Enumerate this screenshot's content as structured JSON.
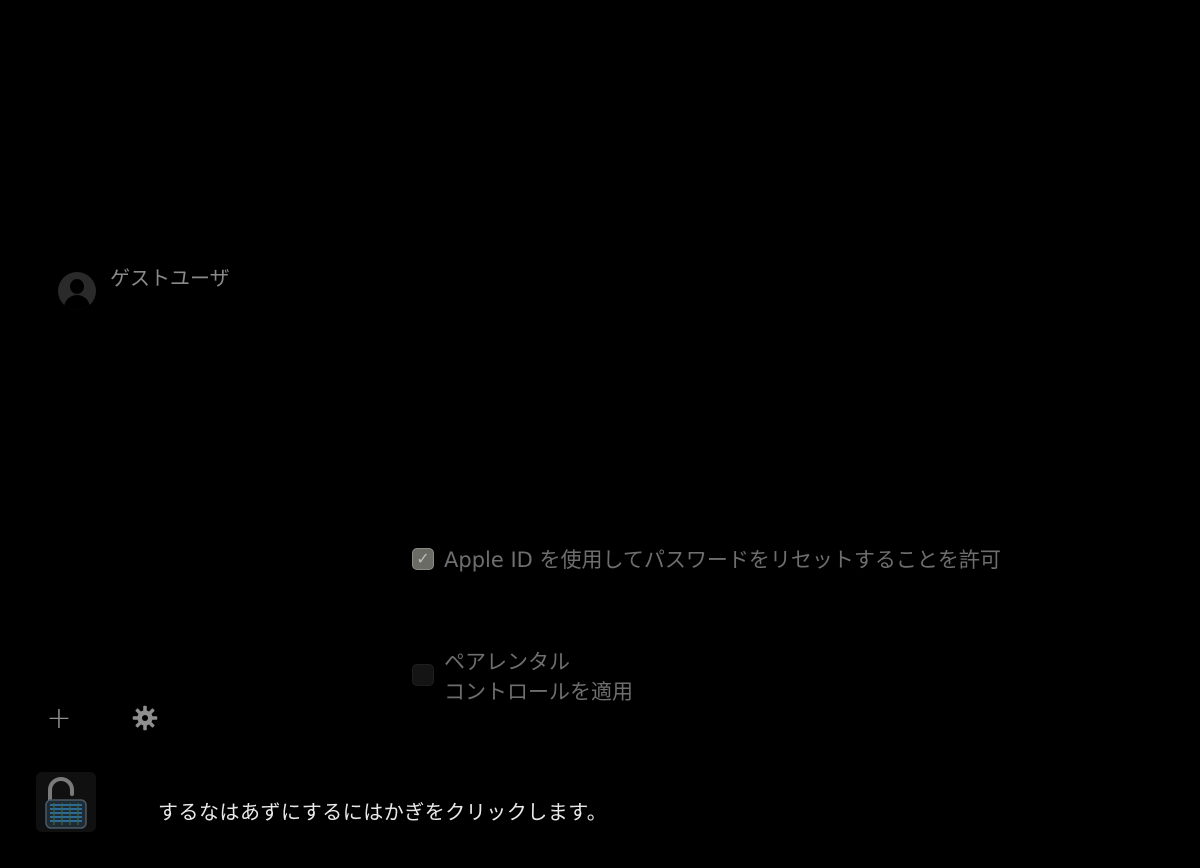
{
  "users": [
    {
      "name": "ゲストユーザ",
      "icon": "avatar-icon"
    }
  ],
  "options": {
    "reset_password_apple_id": {
      "label": "Apple ID を使用してパスワードをリセットすることを許可",
      "checked": true
    },
    "parental_controls": {
      "label_line1": "ペアレンタル",
      "label_line2": "コントロールを適用",
      "checked": false
    }
  },
  "toolbar": {
    "add_label": "+",
    "add_icon": "plus-icon",
    "settings_icon": "gear-icon"
  },
  "lock": {
    "icon": "padlock-icon",
    "message": "するなはあずにするにはかぎをクリックします。"
  },
  "colors": {
    "background": "#000000",
    "text_dim": "#8a8a8a",
    "text_bright": "#e8e8e8",
    "checkbox_checked": "#6b6b66"
  }
}
